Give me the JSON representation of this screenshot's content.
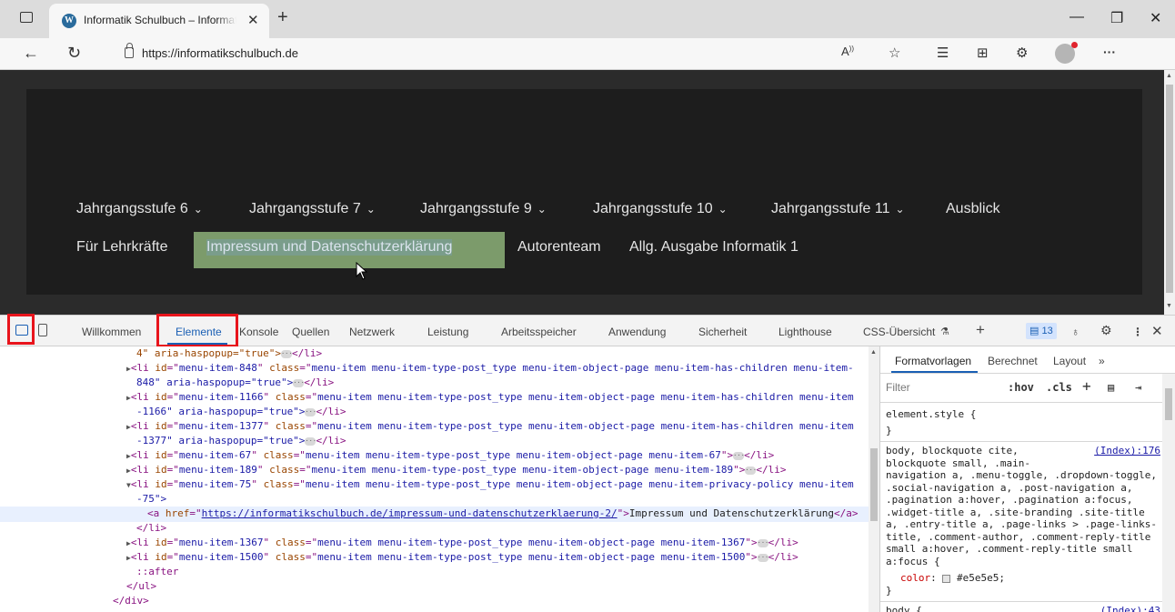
{
  "browser": {
    "tab_title": "Informatik Schulbuch – Informatik",
    "tab_close": "✕",
    "new_tab": "+",
    "url": "https://informatikschulbuch.de",
    "window_minimize": "—",
    "window_restore": "❐",
    "window_close": "✕"
  },
  "nav": {
    "row1": [
      {
        "label": "Jahrgangsstufe 6",
        "has_dropdown": true
      },
      {
        "label": "Jahrgangsstufe 7",
        "has_dropdown": true
      },
      {
        "label": "Jahrgangsstufe 9",
        "has_dropdown": true
      },
      {
        "label": "Jahrgangsstufe 10",
        "has_dropdown": true
      },
      {
        "label": "Jahrgangsstufe 11",
        "has_dropdown": true
      },
      {
        "label": "Ausblick",
        "has_dropdown": false
      }
    ],
    "row2": [
      {
        "label": "Für Lehrkräfte"
      },
      {
        "label": "Impressum und Datenschutzerklärung"
      },
      {
        "label": "Autorenteam"
      },
      {
        "label": "Allg. Ausgabe Informatik 1"
      }
    ],
    "chevron": "⌄"
  },
  "devtools": {
    "tabs": [
      "Willkommen",
      "Elemente",
      "Konsole",
      "Quellen",
      "Netzwerk",
      "Leistung",
      "Arbeitsspeicher",
      "Anwendung",
      "Sicherheit",
      "Lighthouse",
      "CSS-Übersicht"
    ],
    "active_tab": "Elemente",
    "issues_count": "13",
    "styles_tabs": [
      "Formatvorlagen",
      "Berechnet",
      "Layout",
      "»"
    ],
    "filter_placeholder": "Filter",
    "hov_label": ":hov",
    "cls_label": ".cls"
  },
  "elements_code": {
    "l0": "4\" aria-haspopup=\"true\">",
    "items": [
      {
        "id": "menu-item-848",
        "cls": "menu-item menu-item-type-post_type menu-item-object-page menu-item-has-children menu-item-",
        "cont": "848\" aria-haspopup=\"true\">"
      },
      {
        "id": "menu-item-1166",
        "cls": "menu-item menu-item-type-post_type menu-item-object-page menu-item-has-children menu-item",
        "cont": "-1166\" aria-haspopup=\"true\">"
      },
      {
        "id": "menu-item-1377",
        "cls": "menu-item menu-item-type-post_type menu-item-object-page menu-item-has-children menu-item",
        "cont": "-1377\" aria-haspopup=\"true\">"
      },
      {
        "id": "menu-item-67",
        "cls": "menu-item menu-item-type-post_type menu-item-object-page menu-item-67"
      },
      {
        "id": "menu-item-189",
        "cls": "menu-item menu-item-type-post_type menu-item-object-page menu-item-189"
      }
    ],
    "item75_id": "menu-item-75",
    "item75_cls": "menu-item menu-item-type-post_type menu-item-object-page menu-item-privacy-policy menu-item",
    "item75_cont": "-75\">",
    "a_href": "https://informatikschulbuch.de/impressum-und-datenschutzerklaerung-2/",
    "a_text": "Impressum und Datenschutzerklärung",
    "close_li": "</li>",
    "item1367_id": "menu-item-1367",
    "item1367_cls": "menu-item menu-item-type-post_type menu-item-object-page menu-item-1367",
    "item1500_id": "menu-item-1500",
    "item1500_cls": "menu-item menu-item-type-post_type menu-item-object-page menu-item-1500",
    "after": "::after",
    "close_ul": "</ul>",
    "close_div": "</div>"
  },
  "styles_code": {
    "element_style": "element.style {",
    "close_brace": "}",
    "rule1_selector": "body, blockquote cite,\nblockquote small, .main-\nnavigation a, .menu-toggle, .dropdown-toggle,\n.social-navigation a, .post-navigation a,\n.pagination a:hover, .pagination a:focus,\n.widget-title a, .site-branding .site-title\na, .entry-title a, .page-links > .page-links-\ntitle, .comment-author, .comment-reply-title\nsmall a:hover, .comment-reply-title small\na:focus {",
    "rule1_source": "(Index):176",
    "rule1_prop": "color",
    "rule1_value": "#e5e5e5;",
    "rule2_selector": "body {",
    "rule2_source": "(Index):43"
  },
  "colors": {
    "accent_blue": "#1a5fb4",
    "highlight_red": "#e8141c",
    "page_bg": "#1d1d1d",
    "menu_text": "#e5e5e5",
    "menu_hover_bg": "#7c9b6b"
  }
}
